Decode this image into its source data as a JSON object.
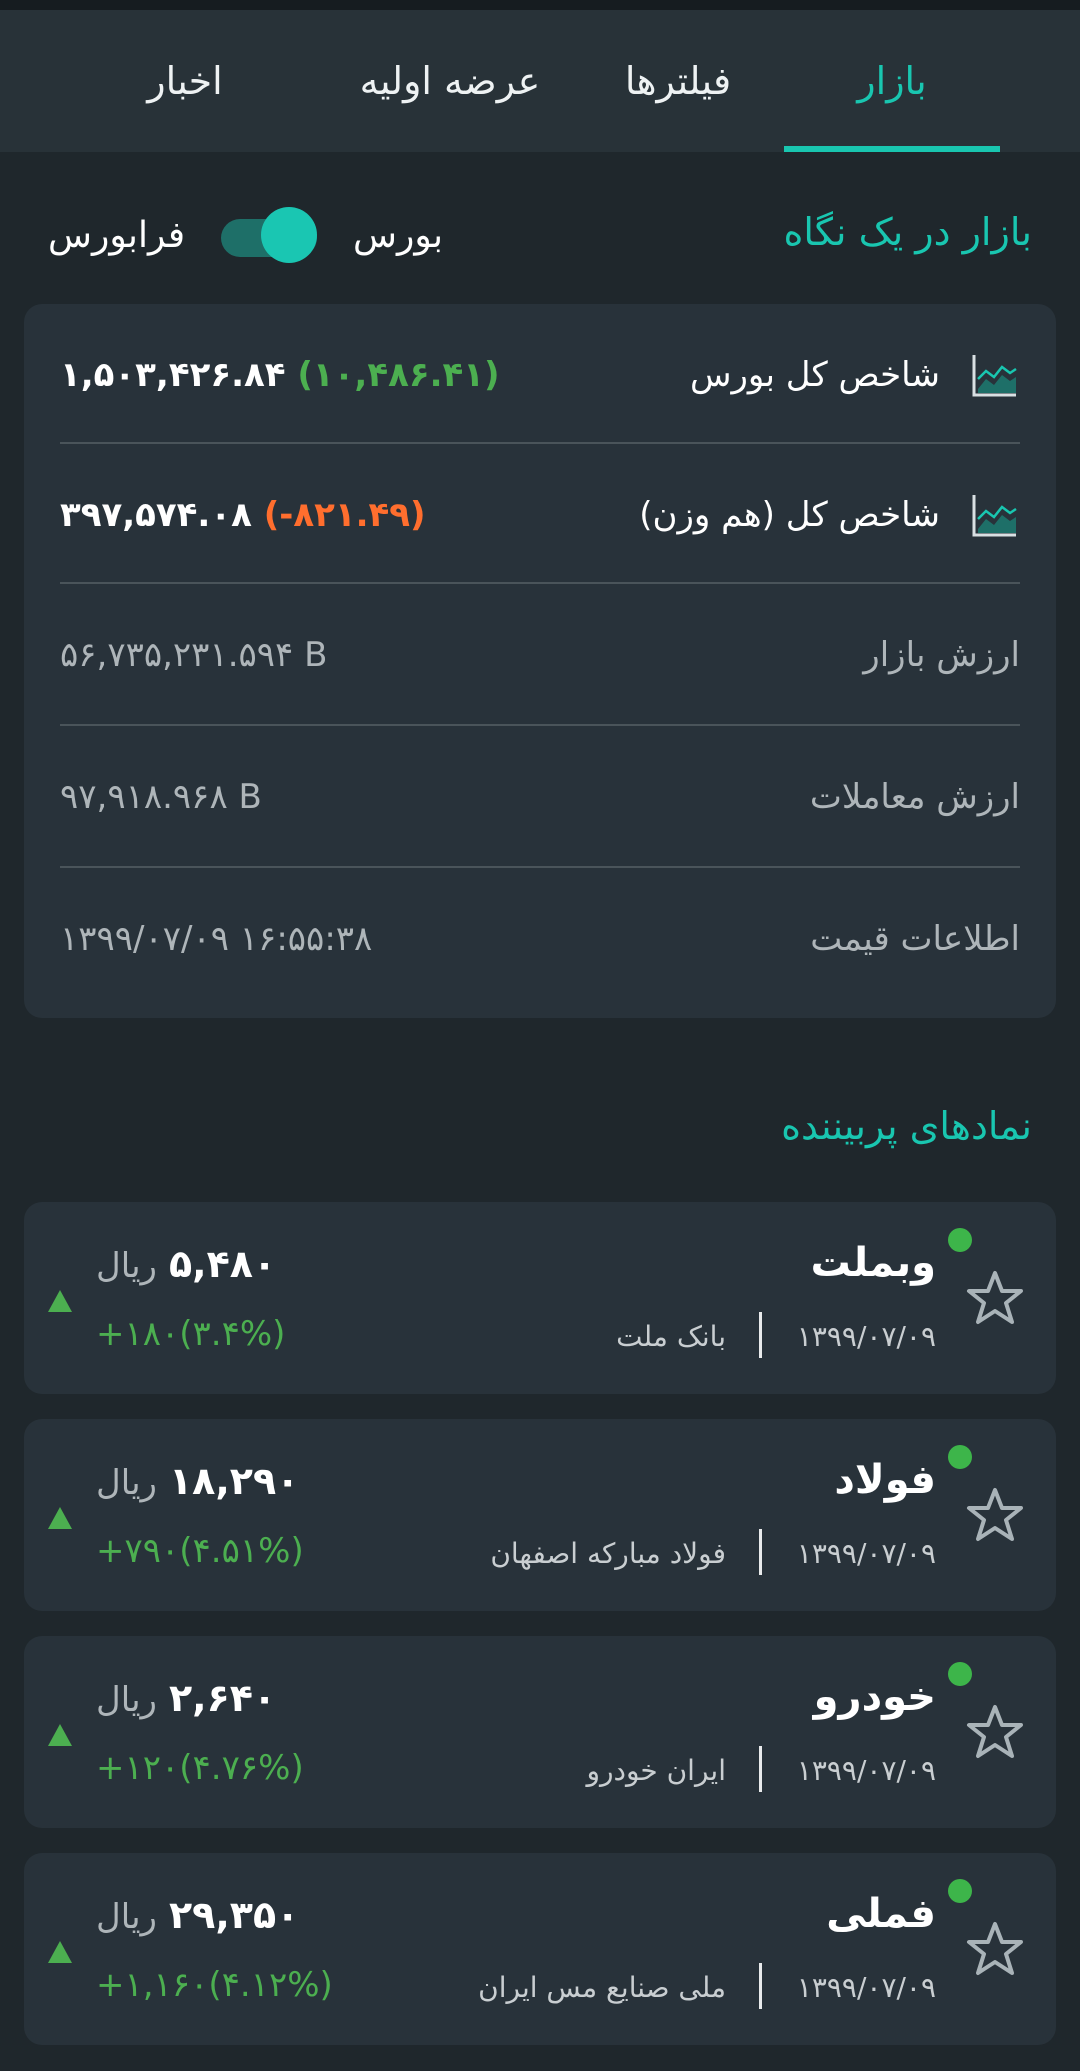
{
  "tabs": [
    {
      "label": "بازار",
      "active": true
    },
    {
      "label": "فیلترها",
      "active": false
    },
    {
      "label": "عرضه اولیه",
      "active": false
    },
    {
      "label": "اخبار",
      "active": false
    }
  ],
  "overview": {
    "title": "بازار در یک نگاه",
    "toggle": {
      "left_label": "فرابورس",
      "right_label": "بورس",
      "selected": "بورس"
    },
    "rows": [
      {
        "label": "شاخص کل بورس",
        "icon": "chart-icon",
        "value": "۱,۵۰۳,۴۲۶.۸۴",
        "change": "(۱۰,۴۸۶.۴۱)",
        "change_color": "#4caf50"
      },
      {
        "label": "شاخص کل (هم وزن)",
        "icon": "chart-icon",
        "value": "۳۹۷,۵۷۴.۰۸",
        "change": "(-۸۲۱.۴۹)",
        "change_color": "#ff6e2e"
      },
      {
        "label": "ارزش بازار",
        "value": "۵۶,۷۳۵,۲۳۱.۵۹۴ B"
      },
      {
        "label": "ارزش معاملات",
        "value": "۹۷,۹۱۸.۹۶۸ B"
      },
      {
        "label": "اطلاعات قیمت",
        "value": "۱۳۹۹/۰۷/۰۹ ۱۶:۵۵:۳۸"
      }
    ]
  },
  "popular": {
    "title": "نمادهای پربیننده",
    "items": [
      {
        "symbol": "وبملت",
        "company": "بانک ملت",
        "date": "۱۳۹۹/۰۷/۰۹",
        "price": "۵,۴۸۰",
        "unit": "ریال",
        "change": "+۱۸۰(۳.۴%)"
      },
      {
        "symbol": "فولاد",
        "company": "فولاد مبارکه اصفهان",
        "date": "۱۳۹۹/۰۷/۰۹",
        "price": "۱۸,۲۹۰",
        "unit": "ریال",
        "change": "+۷۹۰(۴.۵۱%)"
      },
      {
        "symbol": "خودرو",
        "company": "ایران خودرو",
        "date": "۱۳۹۹/۰۷/۰۹",
        "price": "۲,۶۴۰",
        "unit": "ریال",
        "change": "+۱۲۰(۴.۷۶%)"
      },
      {
        "symbol": "فملی",
        "company": "ملی صنایع مس ایران",
        "date": "۱۳۹۹/۰۷/۰۹",
        "price": "۲۹,۳۵۰",
        "unit": "ریال",
        "change": "+۱,۱۶۰(۴.۱۲%)"
      }
    ]
  },
  "colors": {
    "accent": "#19c6b0",
    "positive": "#4caf50",
    "negative": "#ff6e2e",
    "background": "#1f272c",
    "card": "#28323a"
  }
}
